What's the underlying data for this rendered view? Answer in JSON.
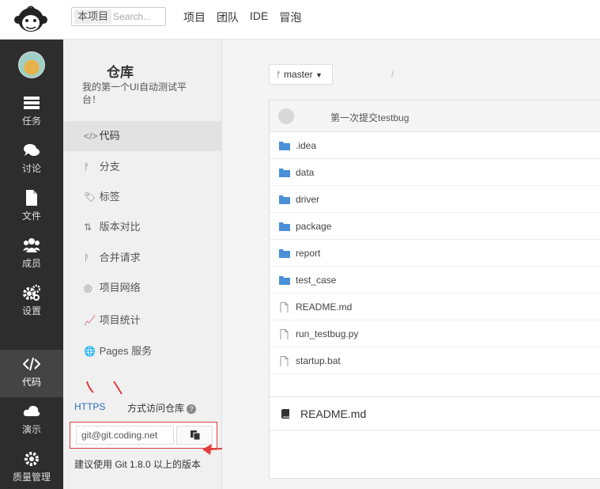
{
  "topbar": {
    "search_scope": "本项目",
    "search_placeholder": "Search...",
    "nav": [
      "项目",
      "团队",
      "IDE",
      "冒泡"
    ]
  },
  "leftnav": {
    "items": [
      {
        "label": "任务",
        "icon": "tasks-icon"
      },
      {
        "label": "讨论",
        "icon": "chat-icon"
      },
      {
        "label": "文件",
        "icon": "file-icon"
      },
      {
        "label": "成员",
        "icon": "members-icon"
      },
      {
        "label": "设置",
        "icon": "gear-icon"
      },
      {
        "label": "代码",
        "icon": "code-icon"
      },
      {
        "label": "演示",
        "icon": "cloud-icon"
      },
      {
        "label": "质量管理",
        "icon": "quality-icon"
      }
    ]
  },
  "sidebar": {
    "title": "仓库",
    "description": "我的第一个UI自动测试平台！",
    "items": [
      {
        "label": "代码",
        "icon": "</>"
      },
      {
        "label": "分支",
        "icon": "ᚠ"
      },
      {
        "label": "标签",
        "icon": "🏷"
      },
      {
        "label": "版本对比",
        "icon": "⇅"
      },
      {
        "label": "合并请求",
        "icon": "ᚹ"
      },
      {
        "label": "项目网络",
        "icon": "◎"
      },
      {
        "label": "项目统计",
        "icon": "📈"
      },
      {
        "label": "Pages 服务",
        "icon": "🌐"
      }
    ],
    "https_label": "HTTPS",
    "access_text": "方式访问仓库",
    "clone_url": "git@git.coding.net",
    "git_note": "建议使用 Git 1.8.0 以上的版本"
  },
  "main": {
    "branch": "master",
    "path_sep": "/",
    "commit_message": "第一次提交testbug",
    "files": [
      {
        "name": ".idea",
        "type": "folder"
      },
      {
        "name": "data",
        "type": "folder"
      },
      {
        "name": "driver",
        "type": "folder"
      },
      {
        "name": "package",
        "type": "folder"
      },
      {
        "name": "report",
        "type": "folder"
      },
      {
        "name": "test_case",
        "type": "folder"
      },
      {
        "name": "README.md",
        "type": "file"
      },
      {
        "name": "run_testbug.py",
        "type": "file"
      },
      {
        "name": "startup.bat",
        "type": "file"
      }
    ],
    "readme_title": "README.md"
  },
  "colors": {
    "nav_bg": "#2d2d2d",
    "link": "#2a6ebb",
    "folder": "#4a90d9",
    "annotation": "#e23c3c"
  }
}
